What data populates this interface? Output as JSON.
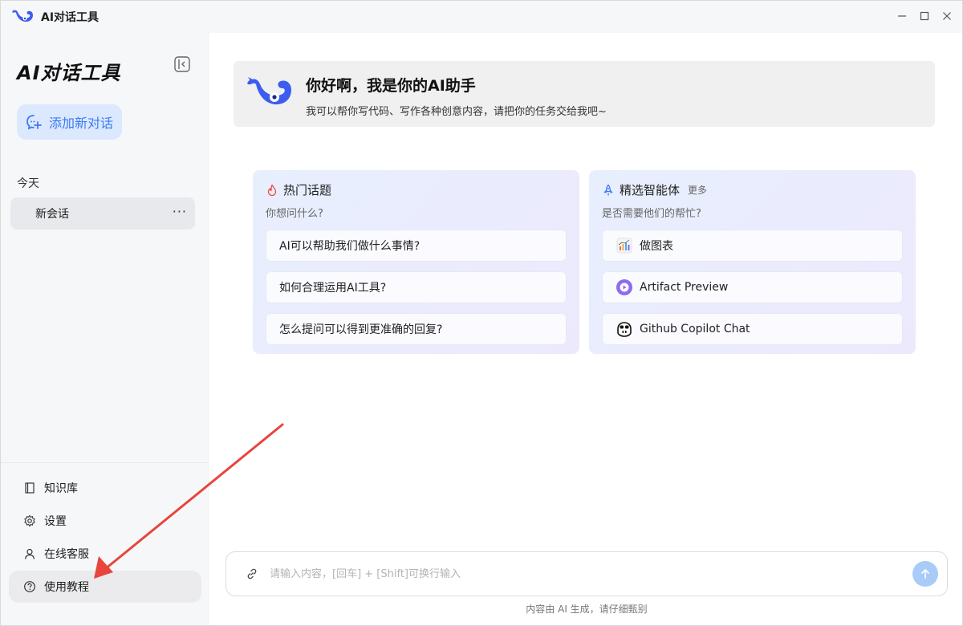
{
  "titlebar": {
    "title": "AI对话工具"
  },
  "sidebar": {
    "brand": "AI对话工具",
    "new_chat_label": "添加新对话",
    "section_today": "今天",
    "session": {
      "label": "新会话",
      "more": "···"
    },
    "bottom_items": [
      {
        "label": "知识库",
        "icon": "book-icon"
      },
      {
        "label": "设置",
        "icon": "gear-icon"
      },
      {
        "label": "在线客服",
        "icon": "user-icon"
      },
      {
        "label": "使用教程",
        "icon": "help-icon"
      }
    ]
  },
  "main": {
    "welcome": {
      "title": "你好啊，我是你的AI助手",
      "subtitle": "我可以帮你写代码、写作各种创意内容，请把你的任务交给我吧~"
    },
    "hot_topics": {
      "title": "热门话题",
      "subtitle": "你想问什么?",
      "items": [
        "AI可以帮助我们做什么事情?",
        "如何合理运用AI工具?",
        "怎么提问可以得到更准确的回复?"
      ]
    },
    "agents": {
      "title": "精选智能体",
      "more": "更多",
      "subtitle": "是否需要他们的帮忙?",
      "items": [
        {
          "label": "做图表",
          "icon": "chart-icon"
        },
        {
          "label": "Artifact Preview",
          "icon": "play-icon"
        },
        {
          "label": "Github Copilot Chat",
          "icon": "copilot-icon"
        }
      ]
    },
    "input": {
      "placeholder": "请输入内容，[回车] + [Shift]可换行输入"
    },
    "disclaimer": "内容由 AI 生成，请仔细甄别"
  },
  "colors": {
    "accent": "#3b7bf6",
    "new_chat_bg": "#dbe8fd",
    "send_button": "#a9cbf8",
    "arrow": "#e8453c",
    "whale": "#3d5cf0"
  }
}
